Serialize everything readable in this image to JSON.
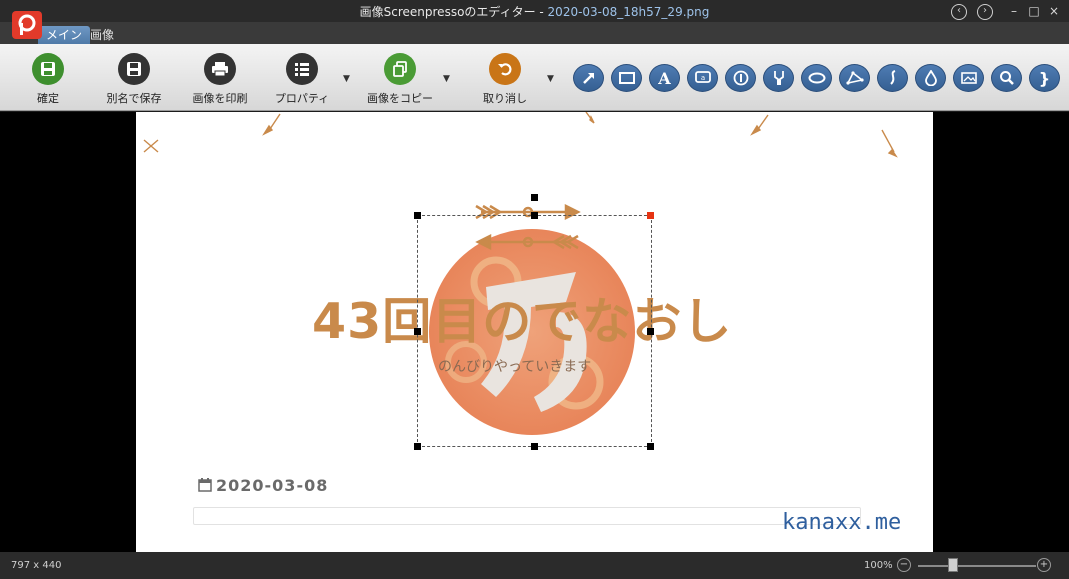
{
  "window": {
    "title_prefix": "画像Screenpressoのエディター  -  ",
    "file_name": "2020-03-08_18h57_29.png",
    "minimize_label": "–",
    "maximize_label": "□",
    "close_label": "×"
  },
  "tabs": [
    {
      "label": "メイン",
      "active": true
    },
    {
      "label": "画像",
      "active": false
    }
  ],
  "ribbon": {
    "confirm_label": "確定",
    "save_as_label": "別名で保存",
    "print_label": "画像を印刷",
    "properties_label": "プロパティ",
    "copy_label": "画像をコピー",
    "undo_label": "取り消し"
  },
  "tools": [
    "arrow-icon",
    "rectangle-icon",
    "text-icon",
    "callout-icon",
    "step-number-icon",
    "highlighter-icon",
    "ellipse-icon",
    "polyline-icon",
    "curve-icon",
    "blur-drop-icon",
    "image-icon",
    "magnifier-icon",
    "brace-icon"
  ],
  "canvas": {
    "headline": "43回目のでなおし",
    "tagline": "のんびりやっていきます",
    "date": "2020-03-08",
    "watermark": "kanaxx.me"
  },
  "status": {
    "dimensions": "797 x 440",
    "zoom": "100%",
    "zoom_value": 0.3
  },
  "colors": {
    "accent_orange": "#c98a4b",
    "tool_blue": "#3f6ea5",
    "confirm_green": "#3e8f2e",
    "undo_orange": "#c97517"
  }
}
